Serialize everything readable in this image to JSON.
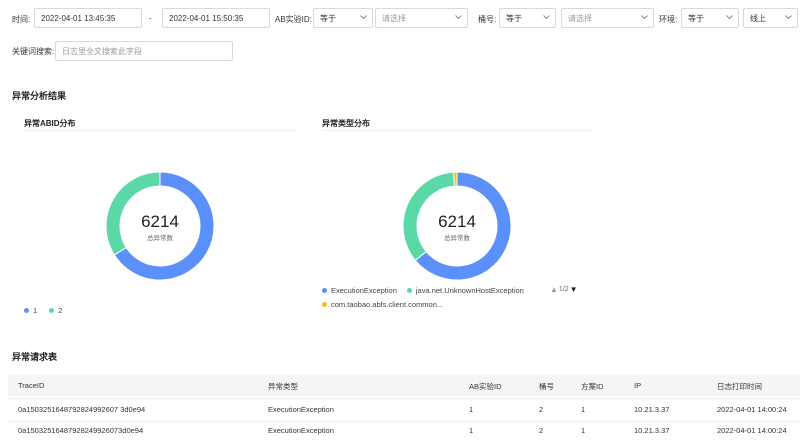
{
  "filters": {
    "time_label": "时间:",
    "start_time": "2022-04-01 13:45:35",
    "range_separator": "-",
    "end_time": "2022-04-01 15:50:35",
    "ab_label": "AB实验ID:",
    "ab_operator": "等于",
    "ab_placeholder": "请选择",
    "bucket_label": "桶号:",
    "bucket_operator": "等于",
    "bucket_placeholder": "请选择",
    "env_label": "环境:",
    "env_operator": "等于",
    "env_value": "线上",
    "keyword_label": "关键词搜索:",
    "keyword_placeholder": "日志里全文搜索此字段"
  },
  "analysis": {
    "title": "异常分析结果",
    "chart1_title": "异常ABID分布",
    "chart2_title": "异常类型分布",
    "pager": "1/2"
  },
  "chart_data": [
    {
      "type": "pie",
      "title": "异常ABID分布",
      "center_value": "6214",
      "center_label": "总异常数",
      "categories": [
        "1",
        "2"
      ],
      "values": [
        0.66,
        0.34
      ],
      "colors": [
        "#5b8ff9",
        "#5ad8a6"
      ]
    },
    {
      "type": "pie",
      "title": "异常类型分布",
      "center_value": "6214",
      "center_label": "总异常数",
      "categories": [
        "ExecutionException",
        "java.net.UnknownHostException",
        "com.taobao.abfs.client.common..."
      ],
      "values": [
        0.64,
        0.35,
        0.01
      ],
      "colors": [
        "#5b8ff9",
        "#5ad8a6",
        "#f6bd16"
      ]
    }
  ],
  "table": {
    "title": "异常请求表",
    "headers": [
      "TraceID",
      "异常类型",
      "AB实验ID",
      "桶号",
      "方案ID",
      "IP",
      "日志打印时间"
    ],
    "rows": [
      [
        "0a1503251648792824992607 3d0e94",
        "ExecutionException",
        "1",
        "2",
        "1",
        "10.21.3.37",
        "2022-04-01 14:00:24"
      ],
      [
        "0a15032516487928249926073d0e94",
        "ExecutionException",
        "1",
        "2",
        "1",
        "10.21.3.37",
        "2022-04-01 14:00:24"
      ]
    ]
  }
}
